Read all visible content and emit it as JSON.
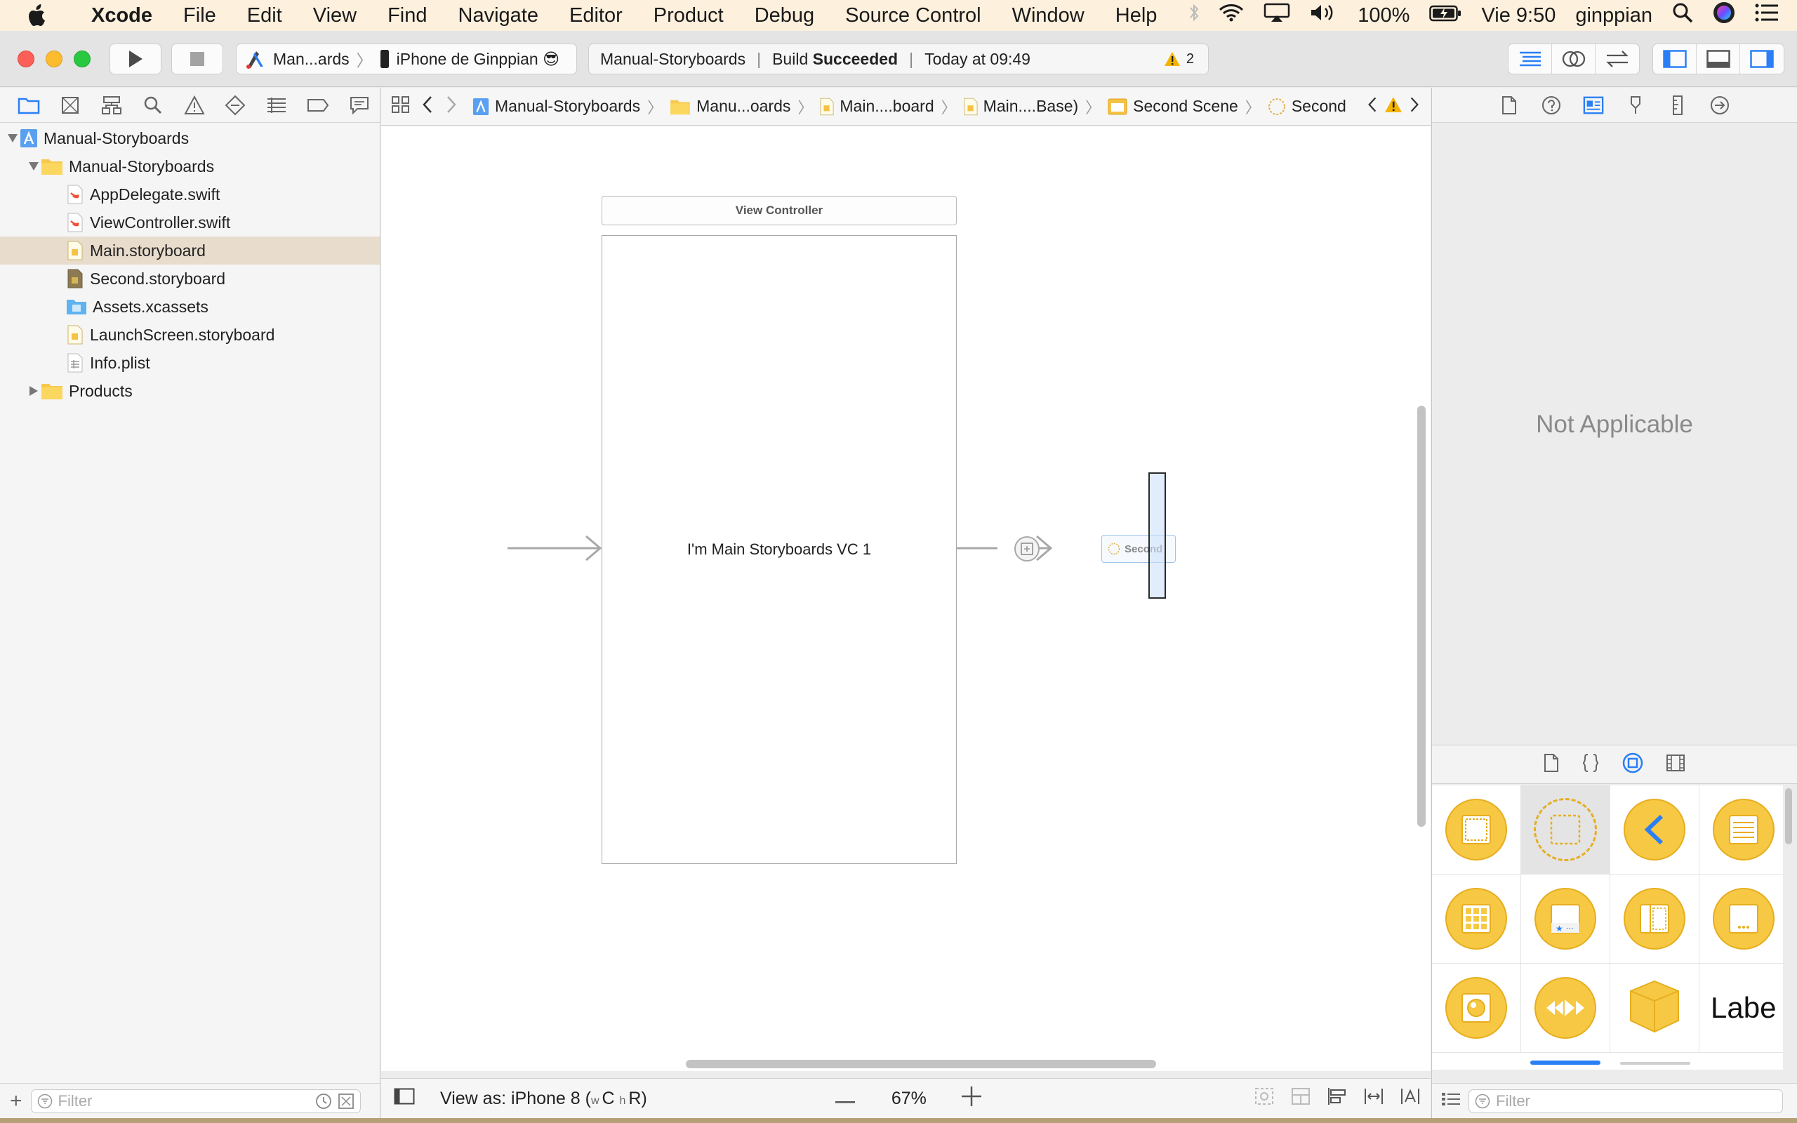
{
  "menubar": {
    "items": [
      "Xcode",
      "File",
      "Edit",
      "View",
      "Find",
      "Navigate",
      "Editor",
      "Product",
      "Debug",
      "Source Control",
      "Window",
      "Help"
    ],
    "battery": "100%",
    "clock": "Vie 9:50",
    "user": "ginppian"
  },
  "toolbar": {
    "scheme_target": "Man...ards",
    "scheme_device": "iPhone de Ginppian 😎",
    "activity_project": "Manual-Storyboards",
    "activity_build_prefix": "Build ",
    "activity_build_status": "Succeeded",
    "activity_time": "Today at 09:49",
    "warning_count": "2"
  },
  "navigator": {
    "tree": [
      {
        "label": "Manual-Storyboards",
        "icon": "project-icon",
        "level": 0,
        "disclosure": "open"
      },
      {
        "label": "Manual-Storyboards",
        "icon": "folder-icon",
        "level": 1,
        "disclosure": "open"
      },
      {
        "label": "AppDelegate.swift",
        "icon": "swift-file-icon",
        "level": 2
      },
      {
        "label": "ViewController.swift",
        "icon": "swift-file-icon",
        "level": 2
      },
      {
        "label": "Main.storyboard",
        "icon": "storyboard-file-icon",
        "level": 2,
        "selected": true
      },
      {
        "label": "Second.storyboard",
        "icon": "storyboard-file-icon",
        "level": 2
      },
      {
        "label": "Assets.xcassets",
        "icon": "assets-folder-icon",
        "level": 2
      },
      {
        "label": "LaunchScreen.storyboard",
        "icon": "storyboard-file-icon",
        "level": 2
      },
      {
        "label": "Info.plist",
        "icon": "plist-file-icon",
        "level": 2
      },
      {
        "label": "Products",
        "icon": "folder-icon",
        "level": 1,
        "disclosure": "closed"
      }
    ],
    "filter_placeholder": "Filter"
  },
  "jumpbar": {
    "crumbs": [
      "Manual-Storyboards",
      "Manu...oards",
      "Main....board",
      "Main....Base)",
      "Second Scene",
      "Second"
    ]
  },
  "canvas": {
    "scene_title": "View Controller",
    "scene_label": "I'm Main Storyboards VC 1",
    "reference_label": "Second"
  },
  "editor_bottom": {
    "view_as_prefix": "View as: iPhone 8 (",
    "view_as_w": "w",
    "view_as_c": "C ",
    "view_as_h": "h",
    "view_as_r": "R)",
    "zoom": "67%"
  },
  "inspector": {
    "empty_message": "Not Applicable",
    "library_label_tile": "Labe",
    "filter_placeholder": "Filter"
  },
  "colors": {
    "accent": "#2a7ff6",
    "library_yellow": "#f7c843",
    "selected_row": "#e8dccc",
    "menubar": "#fdf0dd"
  }
}
